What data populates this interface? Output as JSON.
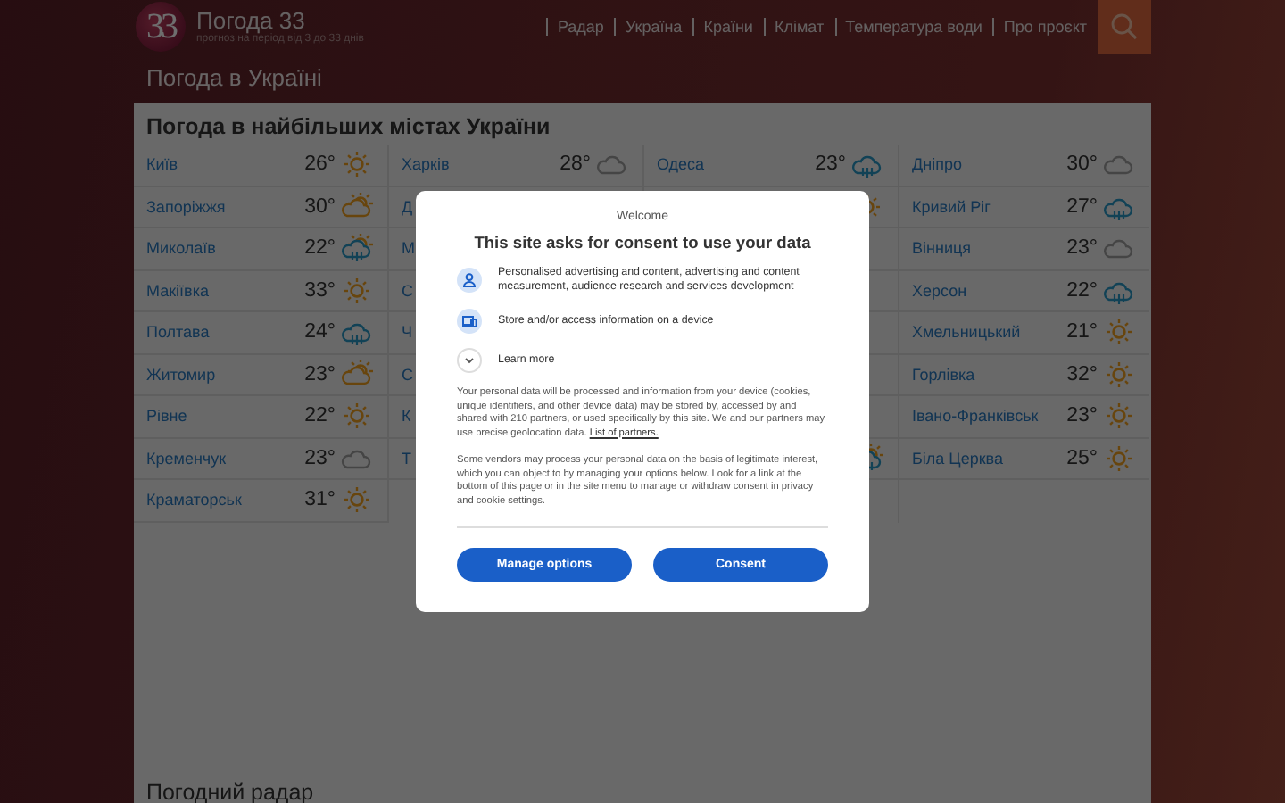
{
  "header": {
    "logo": "33",
    "title": "Погода 33",
    "subtitle": "прогноз на період від 3 до 33 днів",
    "nav": [
      "Радар",
      "Україна",
      "Країни",
      "Клімат",
      "Температура води",
      "Про проєкт"
    ]
  },
  "page_title": "Погода в Україні",
  "cities_section": {
    "title": "Погода в найбільших містах України",
    "columns": [
      [
        {
          "name": "Київ",
          "temp": "26°",
          "kind": "sun"
        },
        {
          "name": "Запоріжжя",
          "temp": "30°",
          "kind": "partly"
        },
        {
          "name": "Миколаїв",
          "temp": "22°",
          "kind": "showers"
        },
        {
          "name": "Макіївка",
          "temp": "33°",
          "kind": "sun"
        },
        {
          "name": "Полтава",
          "temp": "24°",
          "kind": "rain"
        },
        {
          "name": "Житомир",
          "temp": "23°",
          "kind": "partly"
        },
        {
          "name": "Рівне",
          "temp": "22°",
          "kind": "sun"
        },
        {
          "name": "Кременчук",
          "temp": "23°",
          "kind": "cloud"
        },
        {
          "name": "Краматорськ",
          "temp": "31°",
          "kind": "sun"
        }
      ],
      [
        {
          "name": "Харків",
          "temp": "28°",
          "kind": "cloud"
        },
        {
          "name": "Д"
        },
        {
          "name": "М"
        },
        {
          "name": "С"
        },
        {
          "name": "Ч"
        },
        {
          "name": "С"
        },
        {
          "name": "К"
        },
        {
          "name": "Т"
        }
      ],
      [
        {
          "name": "Одеса",
          "temp": "23°",
          "kind": "rain"
        },
        {
          "kind": "sun"
        },
        {},
        {},
        {},
        {},
        {},
        {
          "kind": "showers"
        }
      ],
      [
        {
          "name": "Дніпро",
          "temp": "30°",
          "kind": "cloud"
        },
        {
          "name": "Кривий Ріг",
          "temp": "27°",
          "kind": "rain"
        },
        {
          "name": "Вінниця",
          "temp": "23°",
          "kind": "cloud"
        },
        {
          "name": "Херсон",
          "temp": "22°",
          "kind": "rain"
        },
        {
          "name": "Хмельницький",
          "temp": "21°",
          "kind": "sun"
        },
        {
          "name": "Горлівка",
          "temp": "32°",
          "kind": "sun"
        },
        {
          "name": "Івано-Франківськ",
          "temp": "23°",
          "kind": "sun"
        },
        {
          "name": "Біла Церква",
          "temp": "25°",
          "kind": "sun"
        }
      ]
    ]
  },
  "radar_section": {
    "title": "Погодний радар"
  },
  "consent_dialog": {
    "welcome": "Welcome",
    "title": "This site asks for consent to use your data",
    "purposes": [
      {
        "kind": "person",
        "text": "Personalised advertising and content, advertising and content measurement, audience research and services development"
      },
      {
        "kind": "device",
        "text": "Store and/or access information on a device"
      }
    ],
    "learn_more": "Learn more",
    "paragraph_1": "Your personal data will be processed and information from your device (cookies, unique identifiers, and other device data) may be stored by, accessed by and shared with 210 partners, or used specifically by this site. We and our partners may use precise geolocation data.",
    "partners_link": "List of partners.",
    "paragraph_2": "Some vendors may process your personal data on the basis of legitimate interest, which you can object to by managing your options below. Look for a link at the bottom of this page or in the site menu to manage or withdraw consent in privacy and cookie settings.",
    "buttons": [
      "Manage options",
      "Consent"
    ]
  }
}
